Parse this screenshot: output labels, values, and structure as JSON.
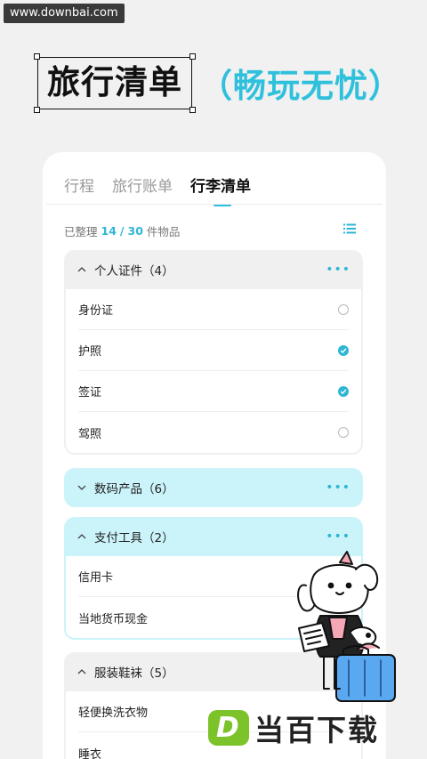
{
  "watermark": "www.downbai.com",
  "headline": {
    "boxed": "旅行清单",
    "accent": "（畅玩无忧）"
  },
  "tabs": [
    {
      "label": "行程",
      "active": false
    },
    {
      "label": "旅行账单",
      "active": false
    },
    {
      "label": "行李清单",
      "active": true
    }
  ],
  "summary": {
    "prefix": "已整理",
    "done": "14",
    "sep": "/",
    "total": "30",
    "suffix": "件物品"
  },
  "groups": [
    {
      "title": "个人证件（4）",
      "more": "•••",
      "expanded": true,
      "items": [
        {
          "label": "身份证",
          "checked": false
        },
        {
          "label": "护照",
          "checked": true
        },
        {
          "label": "签证",
          "checked": true
        },
        {
          "label": "驾照",
          "checked": false
        }
      ]
    },
    {
      "title": "数码产品（6）",
      "more": "•••",
      "expanded": false,
      "items": []
    },
    {
      "title": "支付工具（2）",
      "more": "•••",
      "expanded": true,
      "items": [
        {
          "label": "信用卡",
          "checked": false
        },
        {
          "label": "当地货币现金",
          "checked": false
        }
      ]
    },
    {
      "title": "服装鞋袜（5）",
      "more": "",
      "expanded": true,
      "items": [
        {
          "label": "轻便换洗衣物",
          "checked": false
        },
        {
          "label": "睡衣",
          "checked": false
        }
      ]
    }
  ],
  "brand": {
    "logo_letter": "D",
    "text": "当百下载"
  },
  "colors": {
    "accent": "#2fc0dc",
    "check": "#2fb6d4",
    "cyan_group": "#cbf4fa",
    "brand_green": "#7cc32a"
  }
}
